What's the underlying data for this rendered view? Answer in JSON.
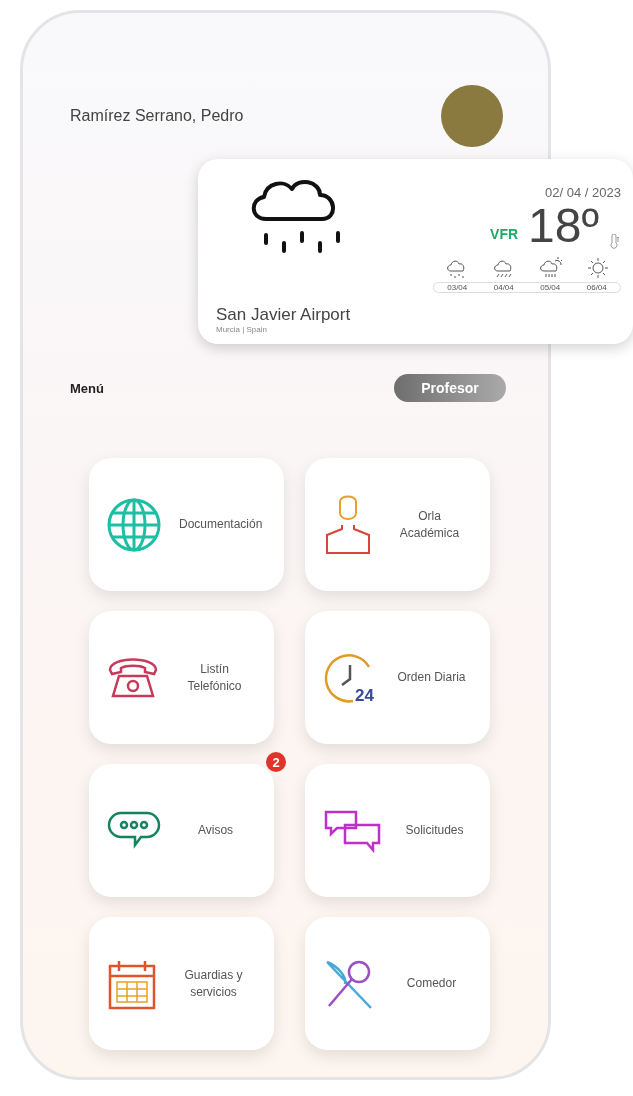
{
  "user": {
    "name": "Ramírez Serrano, Pedro"
  },
  "weather": {
    "date": "02/ 04 / 2023",
    "flight_rule": "VFR",
    "temperature": "18º",
    "location": "San Javier Airport",
    "region": "Murcia | Spain",
    "forecast": [
      {
        "kind": "rain",
        "day": "03/04"
      },
      {
        "kind": "drizzle",
        "day": "04/04"
      },
      {
        "kind": "sun-rain",
        "day": "05/04"
      },
      {
        "kind": "sun",
        "day": "06/04"
      }
    ]
  },
  "menu": {
    "title": "Menú",
    "role": "Profesor"
  },
  "tiles": [
    {
      "label": "Documentación"
    },
    {
      "label": "Orla Académica"
    },
    {
      "label": "Listín Telefónico"
    },
    {
      "label": "Orden Diaria",
      "icon_text": "24"
    },
    {
      "label": "Avisos",
      "badge": "2"
    },
    {
      "label": "Solicitudes"
    },
    {
      "label": "Guardias y servicios"
    },
    {
      "label": "Comedor"
    }
  ]
}
